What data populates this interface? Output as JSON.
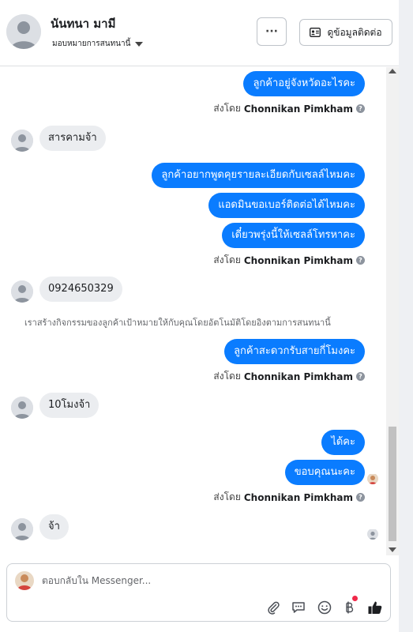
{
  "header": {
    "name": "นันทนา มามี",
    "assign_label": "มอบหมายการสนทนานี้",
    "more_label": "···",
    "contact_button": "ดูข้อมูลติดต่อ"
  },
  "messages": [
    {
      "dir": "out",
      "text": "ลูกค้าอยู่จังหวัดอะไรคะ"
    },
    {
      "sent_prefix": "ส่งโดย",
      "sent_by": "Chonnikan Pimkham"
    },
    {
      "dir": "in",
      "text": "สารคามจ้า"
    },
    {
      "dir": "out",
      "text": "ลูกค้าอยากพูดคุยรายละเอียดกับเซลล์ไหมคะ"
    },
    {
      "dir": "out",
      "text": "แอดมินขอเบอร์ติดต่อได้ไหมคะ"
    },
    {
      "dir": "out",
      "text": "เดี๋ยวพรุ่งนี้ให้เซลล์โทรหาคะ"
    },
    {
      "sent_prefix": "ส่งโดย",
      "sent_by": "Chonnikan Pimkham"
    },
    {
      "dir": "in",
      "text": "0924650329"
    },
    {
      "system": "เราสร้างกิจกรรมของลูกค้าเป้าหมายให้กับคุณโดยอัตโนมัติโดยอิงตามการสนทนานี้"
    },
    {
      "dir": "out",
      "text": "ลูกค้าสะดวกรับสายกี่โมงคะ"
    },
    {
      "sent_prefix": "ส่งโดย",
      "sent_by": "Chonnikan Pimkham"
    },
    {
      "dir": "in",
      "text": "10โมงจ้า"
    },
    {
      "dir": "out",
      "text": "ได้คะ"
    },
    {
      "dir": "out",
      "text": "ขอบคุณนะคะ"
    },
    {
      "sent_prefix": "ส่งโดย",
      "sent_by": "Chonnikan Pimkham"
    },
    {
      "dir": "in",
      "text": "จ้า"
    }
  ],
  "composer": {
    "placeholder": "ตอบกลับใน Messenger...",
    "tools": [
      "paperclip-icon",
      "chat-bubble-icon",
      "smiley-icon",
      "baht-icon",
      "thumbs-up-icon"
    ]
  },
  "colors": {
    "outgoing_bubble": "#0a7cff",
    "incoming_bubble": "#ebedf0",
    "thumbs_up": "#1c1e21",
    "notification_dot": "#f02849"
  }
}
